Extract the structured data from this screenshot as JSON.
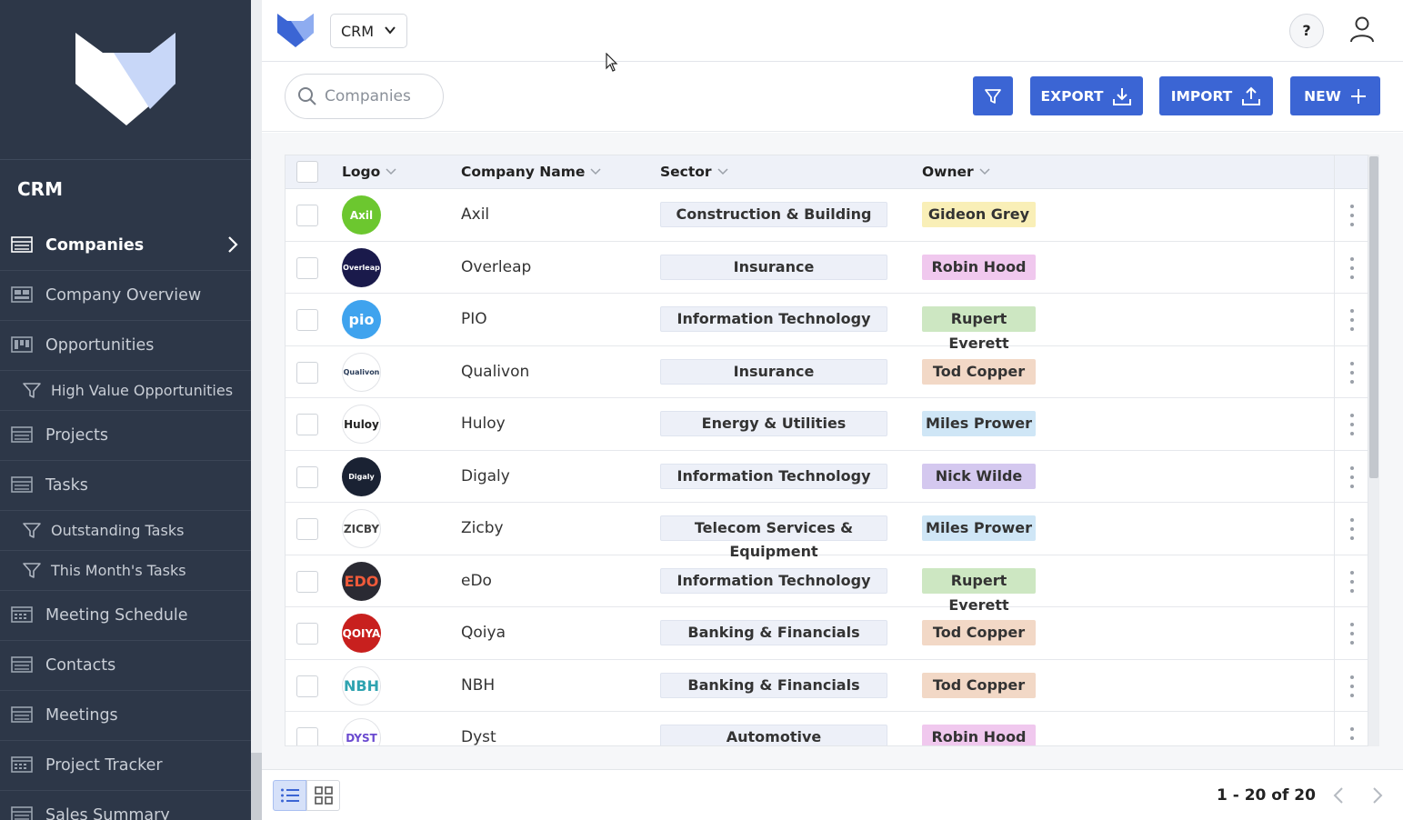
{
  "sidebar": {
    "app_title": "CRM",
    "items": [
      {
        "label": "Companies",
        "icon": "list-icon",
        "active": true
      },
      {
        "label": "Company Overview",
        "icon": "dashboard-icon"
      },
      {
        "label": "Opportunities",
        "icon": "kanban-icon"
      },
      {
        "label": "High Value Opportunities",
        "icon": "filter-icon",
        "sub": true
      },
      {
        "label": "Projects",
        "icon": "list-icon"
      },
      {
        "label": "Tasks",
        "icon": "list-icon"
      },
      {
        "label": "Outstanding Tasks",
        "icon": "filter-icon",
        "sub": true
      },
      {
        "label": "This Month's Tasks",
        "icon": "filter-icon",
        "sub": true
      },
      {
        "label": "Meeting Schedule",
        "icon": "calendar-icon"
      },
      {
        "label": "Contacts",
        "icon": "list-icon"
      },
      {
        "label": "Meetings",
        "icon": "list-icon"
      },
      {
        "label": "Project Tracker",
        "icon": "calendar-icon"
      },
      {
        "label": "Sales Summary",
        "icon": "list-icon"
      }
    ]
  },
  "topbar": {
    "app_selector": "CRM",
    "help_label": "?"
  },
  "toolbar": {
    "search_placeholder": "Companies",
    "export_label": "EXPORT",
    "import_label": "IMPORT",
    "new_label": "NEW"
  },
  "table": {
    "columns": [
      "Logo",
      "Company Name",
      "Sector",
      "Owner"
    ],
    "rows": [
      {
        "logo": "Axil",
        "name": "Axil",
        "sector": "Construction & Building",
        "owner": "Gideon Grey",
        "owner_color": "#f9efb7",
        "logo_bg": "#6cc72f",
        "logo_fg": "#ffffff"
      },
      {
        "logo": "Overleap",
        "name": "Overleap",
        "sector": "Insurance",
        "owner": "Robin Hood",
        "owner_color": "#f0c8ee",
        "logo_bg": "#1a1a4b",
        "logo_fg": "#ffffff"
      },
      {
        "logo": "pio",
        "name": "PIO",
        "sector": "Information Technology",
        "owner": "Rupert Everett",
        "owner_color": "#cde7c2",
        "logo_bg": "#3fa3ee",
        "logo_fg": "#ffffff"
      },
      {
        "logo": "Qualivon",
        "name": "Qualivon",
        "sector": "Insurance",
        "owner": "Tod Copper",
        "owner_color": "#f2d8c6",
        "logo_bg": "#ffffff",
        "logo_fg": "#2b3d5a"
      },
      {
        "logo": "Huloy",
        "name": "Huloy",
        "sector": "Energy & Utilities",
        "owner": "Miles Prower",
        "owner_color": "#cfe6f6",
        "logo_bg": "#ffffff",
        "logo_fg": "#222222"
      },
      {
        "logo": "Digaly",
        "name": "Digaly",
        "sector": "Information Technology",
        "owner": "Nick Wilde",
        "owner_color": "#d4c8ef",
        "logo_bg": "#1a2233",
        "logo_fg": "#ffffff"
      },
      {
        "logo": "ZICBY",
        "name": "Zicby",
        "sector": "Telecom Services & Equipment",
        "owner": "Miles Prower",
        "owner_color": "#cfe6f6",
        "logo_bg": "#ffffff",
        "logo_fg": "#444444"
      },
      {
        "logo": "EDO",
        "name": "eDo",
        "sector": "Information Technology",
        "owner": "Rupert Everett",
        "owner_color": "#cde7c2",
        "logo_bg": "#2a2a33",
        "logo_fg": "#f05a3a"
      },
      {
        "logo": "QOIYA",
        "name": "Qoiya",
        "sector": "Banking & Financials",
        "owner": "Tod Copper",
        "owner_color": "#f2d8c6",
        "logo_bg": "#c8201e",
        "logo_fg": "#ffffff"
      },
      {
        "logo": "NBH",
        "name": "NBH",
        "sector": "Banking & Financials",
        "owner": "Tod Copper",
        "owner_color": "#f2d8c6",
        "logo_bg": "#ffffff",
        "logo_fg": "#2fa3b0"
      },
      {
        "logo": "DYST",
        "name": "Dyst",
        "sector": "Automotive",
        "owner": "Robin Hood",
        "owner_color": "#f0c8ee",
        "logo_bg": "#ffffff",
        "logo_fg": "#6a4ad0"
      }
    ]
  },
  "footer": {
    "pagination": "1 - 20 of 20"
  },
  "colors": {
    "sidebar_bg": "#2d3748",
    "accent": "#3b65d4",
    "header_bg": "#eef1f8"
  }
}
